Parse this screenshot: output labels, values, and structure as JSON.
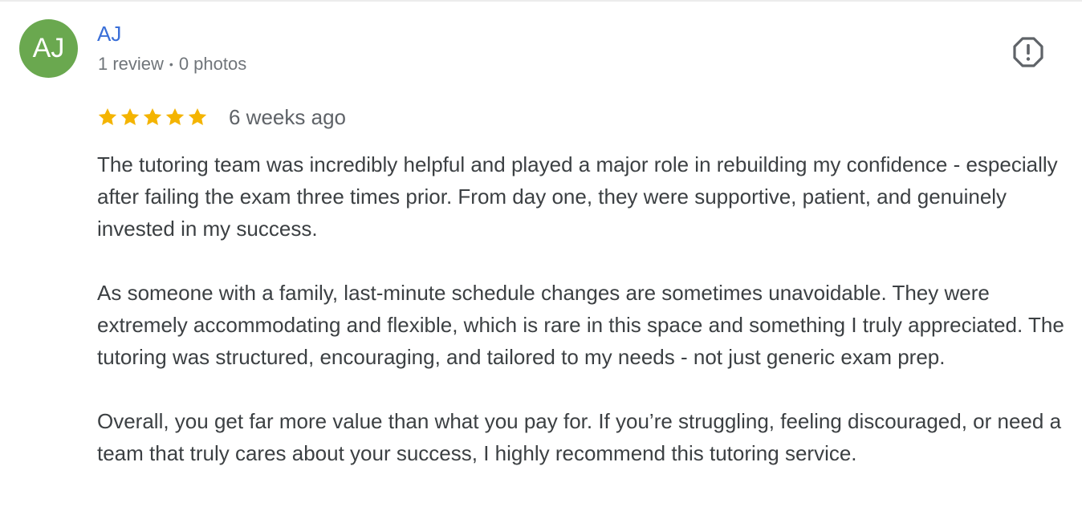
{
  "author": {
    "initials": "AJ",
    "avatar_color": "#6aa84f",
    "name": "AJ",
    "review_count": "1 review",
    "separator": "•",
    "photo_count": "0 photos"
  },
  "report": {
    "icon": "report-flag-icon"
  },
  "review": {
    "rating": 5,
    "max_rating": 5,
    "star_color": "#f4b400",
    "date": "6 weeks ago",
    "paragraphs": [
      "The tutoring team was incredibly helpful and played a major role in rebuilding my confidence - especially after failing the exam three times prior. From day one, they were supportive, patient, and genuinely invested in my success.",
      "As someone with a family, last-minute schedule changes are sometimes unavoidable. They were extremely accommodating and flexible, which is rare in this space and something I truly appreciated. The tutoring was structured, encouraging, and tailored to my needs - not just generic exam prep.",
      "Overall, you get far more value than what you pay for. If you’re struggling, feeling discouraged, or need a team that truly cares about your success, I highly recommend this tutoring service."
    ]
  }
}
